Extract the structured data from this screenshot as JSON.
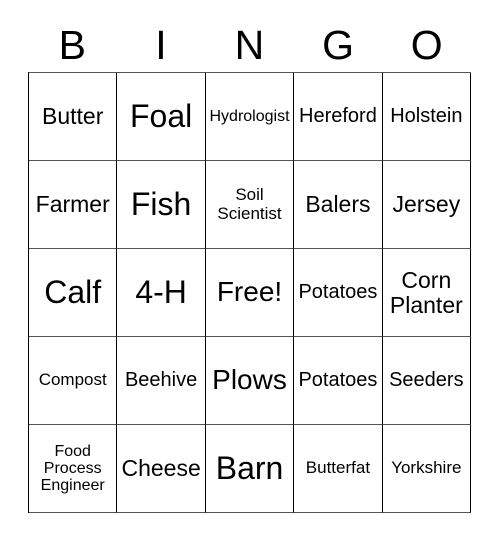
{
  "card": {
    "title": "BINGO",
    "header_letters": [
      "B",
      "I",
      "N",
      "G",
      "O"
    ],
    "free_space_label": "Free!",
    "colors": {
      "background": "#ffffff",
      "text": "#000000",
      "grid_line": "#000000",
      "grid_line_light": "#555555"
    },
    "rows": [
      [
        {
          "text": "Butter",
          "size": "md"
        },
        {
          "text": "Foal",
          "size": "xl"
        },
        {
          "text": "Hydrologist",
          "size": "xxs"
        },
        {
          "text": "Hereford",
          "size": "sm"
        },
        {
          "text": "Holstein",
          "size": "sm"
        }
      ],
      [
        {
          "text": "Farmer",
          "size": "md"
        },
        {
          "text": "Fish",
          "size": "xl"
        },
        {
          "text": "Soil\nScientist",
          "size": "xs"
        },
        {
          "text": "Balers",
          "size": "md"
        },
        {
          "text": "Jersey",
          "size": "md"
        }
      ],
      [
        {
          "text": "Calf",
          "size": "xl"
        },
        {
          "text": "4-H",
          "size": "xl"
        },
        {
          "text": "Free!",
          "size": "lg"
        },
        {
          "text": "Potatoes",
          "size": "sm"
        },
        {
          "text": "Corn\nPlanter",
          "size": "md"
        }
      ],
      [
        {
          "text": "Compost",
          "size": "xs"
        },
        {
          "text": "Beehive",
          "size": "sm"
        },
        {
          "text": "Plows",
          "size": "lg"
        },
        {
          "text": "Potatoes",
          "size": "sm"
        },
        {
          "text": "Seeders",
          "size": "sm"
        }
      ],
      [
        {
          "text": "Food\nProcess\nEngineer",
          "size": "xxs"
        },
        {
          "text": "Cheese",
          "size": "md"
        },
        {
          "text": "Barn",
          "size": "xl"
        },
        {
          "text": "Butterfat",
          "size": "xs"
        },
        {
          "text": "Yorkshire",
          "size": "xs"
        }
      ]
    ]
  }
}
